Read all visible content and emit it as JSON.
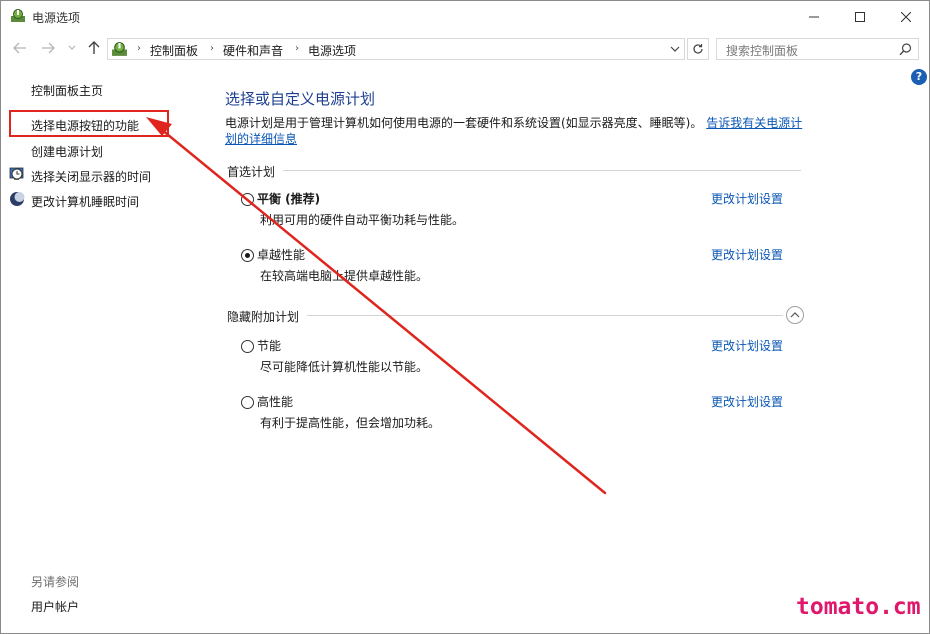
{
  "window": {
    "title": "电源选项",
    "controls": {
      "minimize": "minimize-icon",
      "maximize": "maximize-icon",
      "close": "close-icon"
    }
  },
  "navbar": {
    "breadcrumbs": [
      "控制面板",
      "硬件和声音",
      "电源选项"
    ],
    "search_placeholder": "搜索控制面板"
  },
  "sidebar": {
    "home": "控制面板主页",
    "items": [
      {
        "label": "选择电源按钮的功能",
        "highlighted": true
      },
      {
        "label": "创建电源计划"
      },
      {
        "label": "选择关闭显示器的时间",
        "icon": "display-clock-icon"
      },
      {
        "label": "更改计算机睡眠时间",
        "icon": "moon-icon"
      }
    ],
    "see_also_title": "另请参阅",
    "see_also_items": [
      "用户帐户"
    ]
  },
  "main": {
    "title": "选择或自定义电源计划",
    "description": "电源计划是用于管理计算机如何使用电源的一套硬件和系统设置(如显示器亮度、睡眠等)。",
    "description_link": "告诉我有关电源计划的详细信息",
    "preferred_section": "首选计划",
    "hidden_section": "隐藏附加计划",
    "change_link": "更改计划设置",
    "preferred_plans": [
      {
        "name": "平衡 (推荐)",
        "desc": "利用可用的硬件自动平衡功耗与性能。",
        "selected": false,
        "bold": true
      },
      {
        "name": "卓越性能",
        "desc": "在较高端电脑上提供卓越性能。",
        "selected": true,
        "bold": false
      }
    ],
    "hidden_plans": [
      {
        "name": "节能",
        "desc": "尽可能降低计算机性能以节能。",
        "selected": false
      },
      {
        "name": "高性能",
        "desc": "有利于提高性能，但会增加功耗。",
        "selected": false
      }
    ]
  },
  "annotation": {
    "color": "#e0251e"
  },
  "watermark": "tomato.cm",
  "colors": {
    "link": "#0b57b5",
    "title": "#1e3f91",
    "watermark": "#e0186c"
  }
}
